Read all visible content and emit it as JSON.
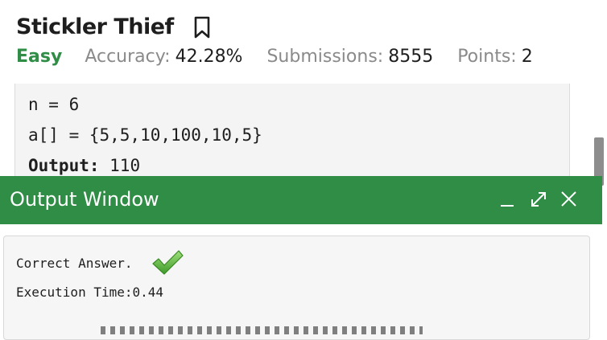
{
  "problem": {
    "title": "Stickler Thief",
    "difficulty": "Easy",
    "stats": [
      {
        "label": "Accuracy:",
        "value": "42.28%"
      },
      {
        "label": "Submissions:",
        "value": "8555"
      },
      {
        "label": "Points:",
        "value": "2"
      }
    ]
  },
  "example": {
    "line1": "n = 6",
    "line2": "a[] = {5,5,10,100,10,5}",
    "output_label": "Output:",
    "output_value": " 110"
  },
  "output_window": {
    "title": "Output Window",
    "result_text": "Correct Answer.",
    "execution_time": "Execution Time:0.44"
  },
  "colors": {
    "brand_green": "#2f8d46",
    "check_green": "#6cc04a"
  },
  "icons": {
    "bookmark": "bookmark-icon",
    "minimize": "minimize-icon",
    "maximize": "maximize-icon",
    "close": "close-icon",
    "success": "checkmark-icon"
  }
}
